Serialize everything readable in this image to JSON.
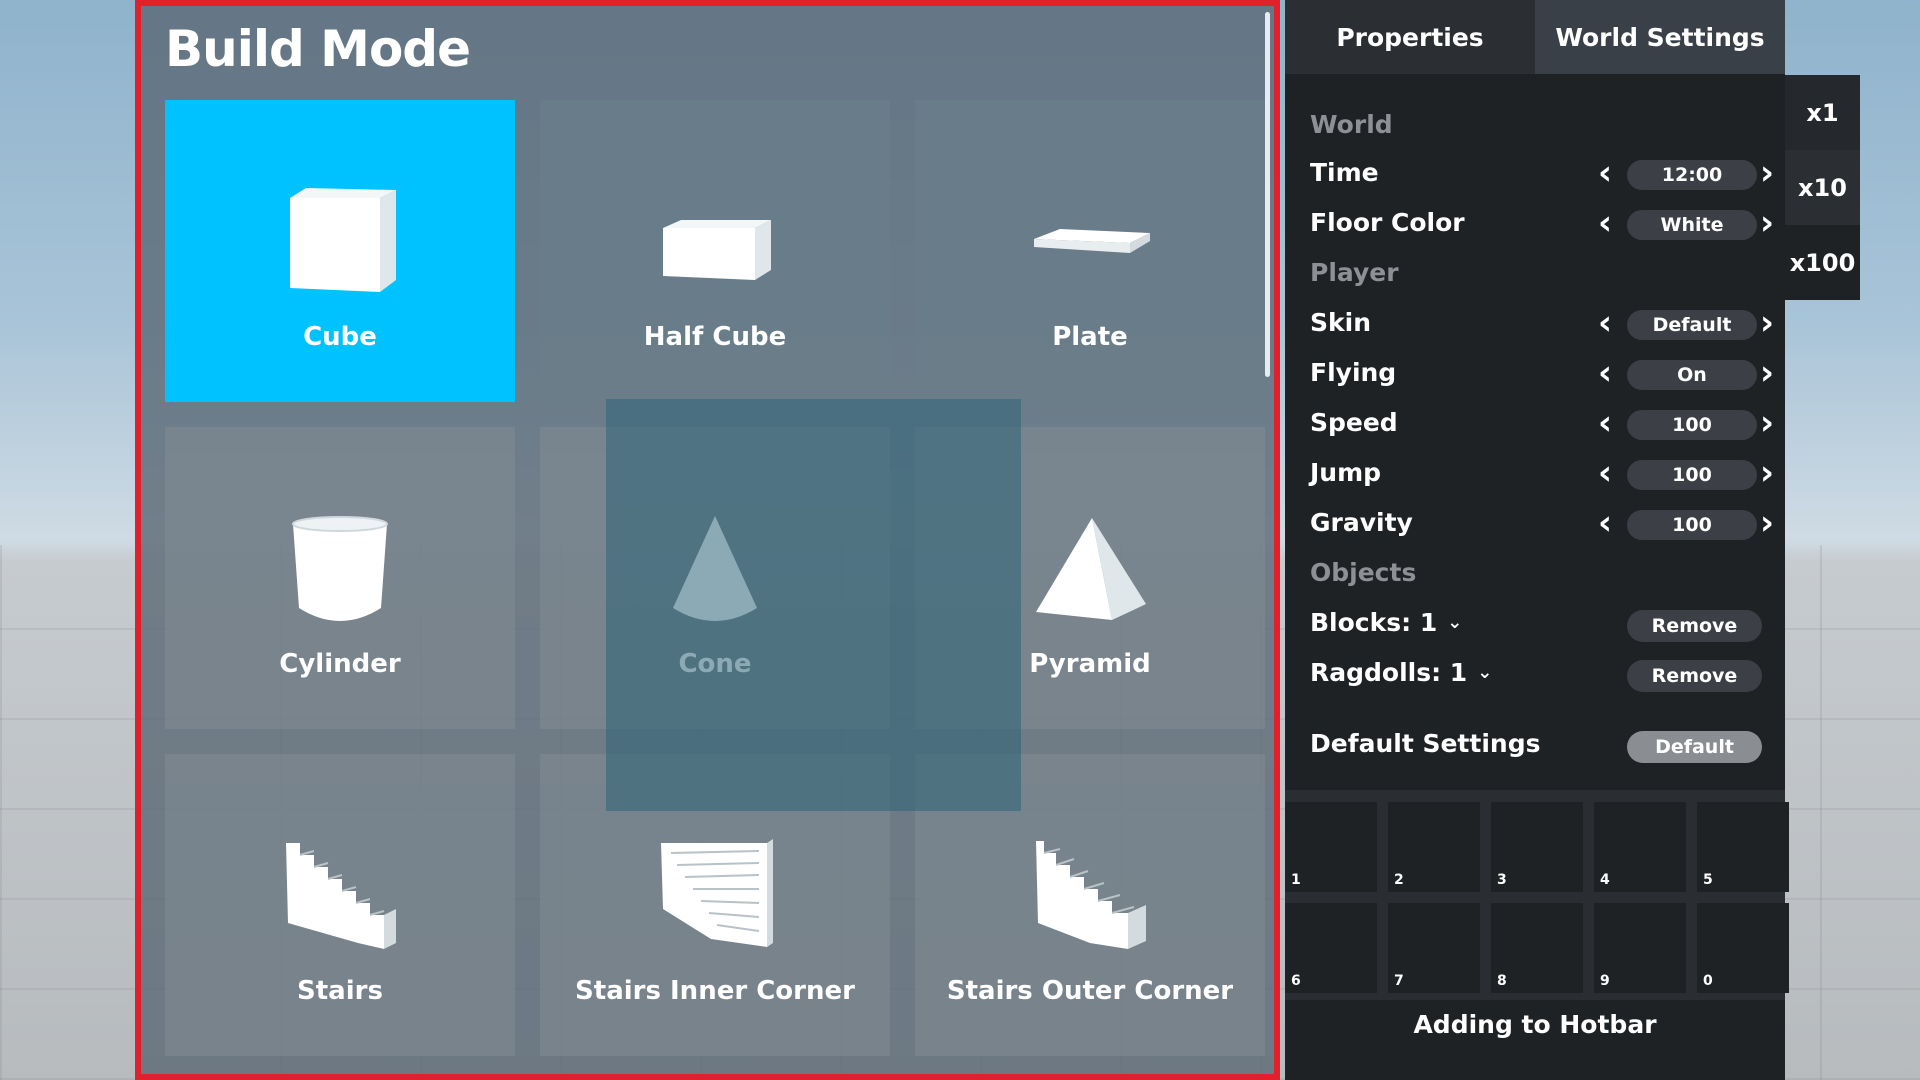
{
  "build_mode": {
    "title": "Build Mode",
    "shapes": [
      {
        "label": "Cube",
        "icon": "cube-icon",
        "selected": true
      },
      {
        "label": "Half Cube",
        "icon": "half-cube-icon"
      },
      {
        "label": "Plate",
        "icon": "plate-icon"
      },
      {
        "label": "Cylinder",
        "icon": "cylinder-icon"
      },
      {
        "label": "Cone",
        "icon": "cone-icon"
      },
      {
        "label": "Pyramid",
        "icon": "pyramid-icon"
      },
      {
        "label": "Stairs",
        "icon": "stairs-icon"
      },
      {
        "label": "Stairs Inner Corner",
        "icon": "stairs-inner-corner-icon"
      },
      {
        "label": "Stairs Outer Corner",
        "icon": "stairs-outer-corner-icon"
      }
    ]
  },
  "tabs": {
    "properties": "Properties",
    "world_settings": "World Settings"
  },
  "world": {
    "header": "World",
    "time": {
      "label": "Time",
      "value": "12:00"
    },
    "floor_color": {
      "label": "Floor Color",
      "value": "White"
    }
  },
  "player": {
    "header": "Player",
    "skin": {
      "label": "Skin",
      "value": "Default"
    },
    "flying": {
      "label": "Flying",
      "value": "On"
    },
    "speed": {
      "label": "Speed",
      "value": "100"
    },
    "jump": {
      "label": "Jump",
      "value": "100"
    },
    "gravity": {
      "label": "Gravity",
      "value": "100"
    }
  },
  "objects": {
    "header": "Objects",
    "blocks": {
      "label": "Blocks: 1",
      "action": "Remove"
    },
    "ragdolls": {
      "label": "Ragdolls: 1",
      "action": "Remove"
    }
  },
  "default_settings": {
    "label": "Default Settings",
    "action": "Default"
  },
  "hotbar": {
    "slots": [
      "1",
      "2",
      "3",
      "4",
      "5",
      "6",
      "7",
      "8",
      "9",
      "0"
    ],
    "footer": "Adding to Hotbar"
  },
  "multipliers": [
    "x1",
    "x10",
    "x100"
  ],
  "colors": {
    "selected_tile": "#00c2ff",
    "panel_border": "#e0212b"
  }
}
